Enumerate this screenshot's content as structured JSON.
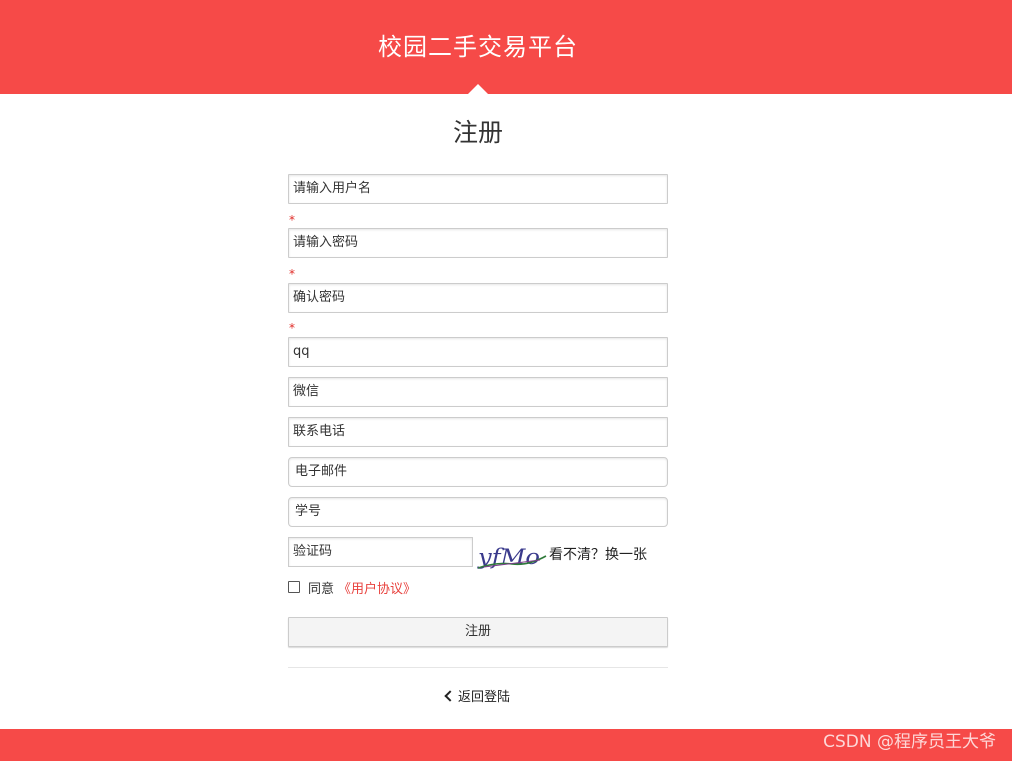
{
  "header": {
    "title": "校园二手交易平台"
  },
  "form": {
    "title": "注册",
    "required_mark": "*",
    "fields": {
      "username_placeholder": "请输入用户名",
      "password_placeholder": "请输入密码",
      "confirm_password_placeholder": "确认密码",
      "qq_placeholder": "qq",
      "wechat_placeholder": "微信",
      "phone_placeholder": "联系电话",
      "email_placeholder": "电子邮件",
      "student_id_placeholder": "学号",
      "captcha_placeholder": "验证码"
    },
    "captcha": {
      "code": "yfMo",
      "refresh_label": "看不清？换一张"
    },
    "agree": {
      "label": "同意",
      "link": "《用户协议》"
    },
    "submit_label": "注册",
    "back_label": "返回登陆"
  },
  "colors": {
    "brand": "#f64a48",
    "link": "#e8413d",
    "required": "#e02b27"
  },
  "watermark": "CSDN @程序员王大爷"
}
